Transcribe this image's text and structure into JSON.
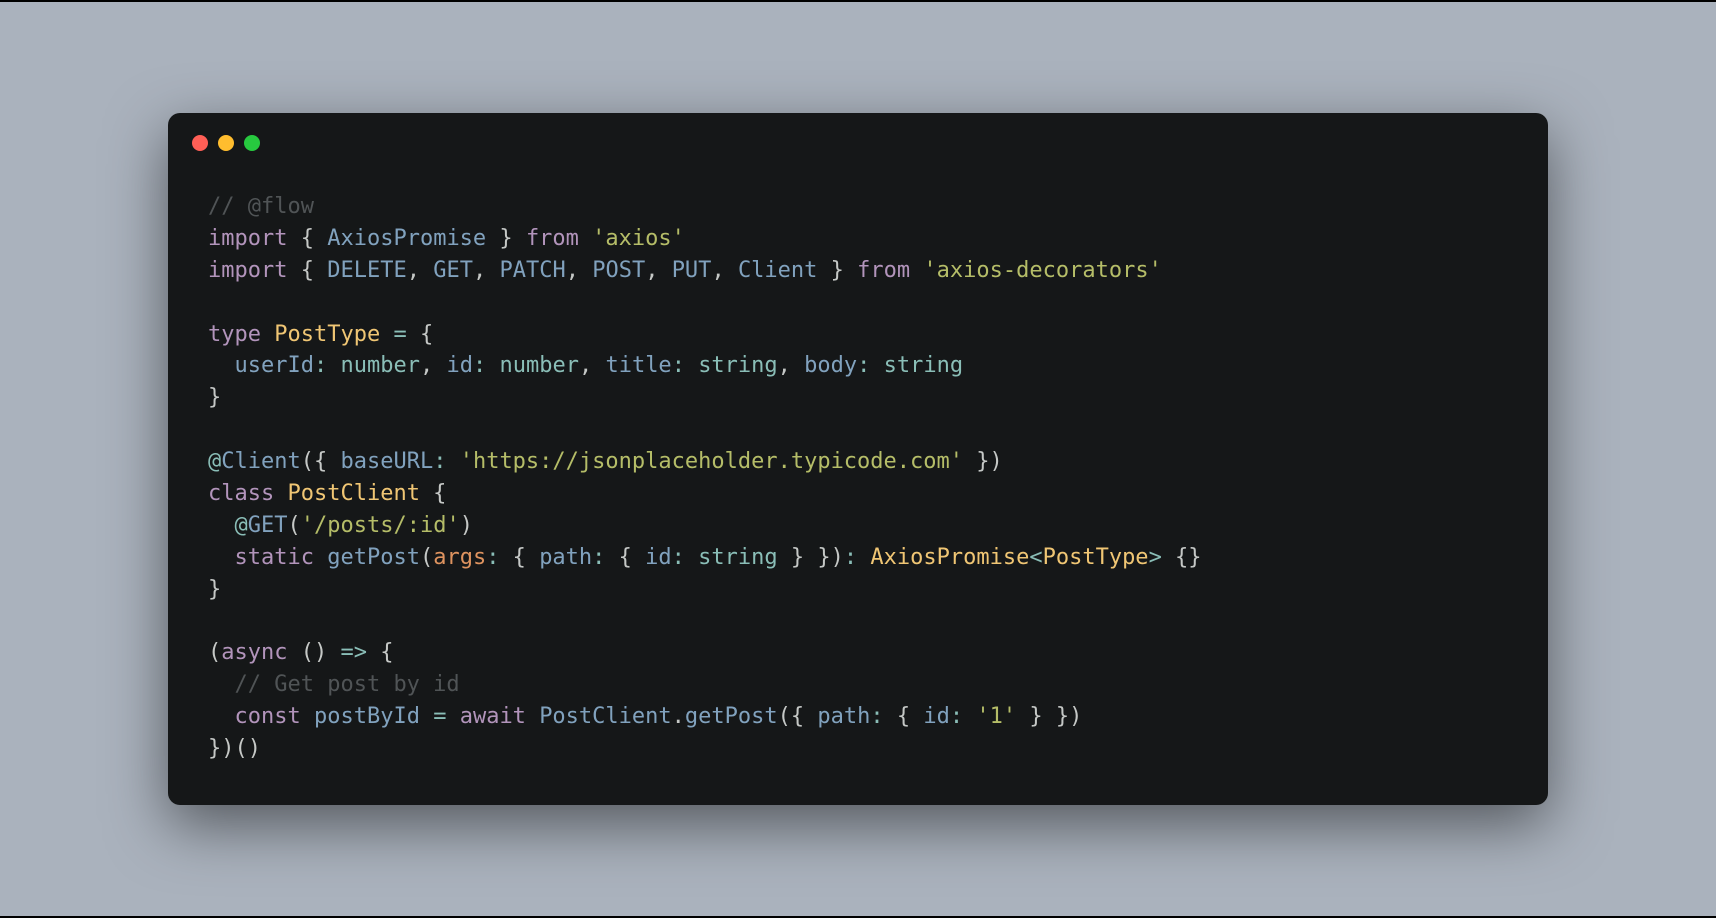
{
  "window": {
    "traffic_lights": [
      "red",
      "yellow",
      "green"
    ]
  },
  "code": {
    "lines": [
      [
        [
          "cm",
          "// @flow"
        ]
      ],
      [
        [
          "kw",
          "import"
        ],
        [
          "br",
          " { "
        ],
        [
          "fn",
          "AxiosPromise"
        ],
        [
          "br",
          " } "
        ],
        [
          "kw",
          "from"
        ],
        [
          "br",
          " "
        ],
        [
          "str",
          "'axios'"
        ]
      ],
      [
        [
          "kw",
          "import"
        ],
        [
          "br",
          " { "
        ],
        [
          "fn",
          "DELETE"
        ],
        [
          "br",
          ", "
        ],
        [
          "fn",
          "GET"
        ],
        [
          "br",
          ", "
        ],
        [
          "fn",
          "PATCH"
        ],
        [
          "br",
          ", "
        ],
        [
          "fn",
          "POST"
        ],
        [
          "br",
          ", "
        ],
        [
          "fn",
          "PUT"
        ],
        [
          "br",
          ", "
        ],
        [
          "fn",
          "Client"
        ],
        [
          "br",
          " } "
        ],
        [
          "kw",
          "from"
        ],
        [
          "br",
          " "
        ],
        [
          "str",
          "'axios-decorators'"
        ]
      ],
      [
        [
          "br",
          ""
        ]
      ],
      [
        [
          "kw",
          "type"
        ],
        [
          "br",
          " "
        ],
        [
          "yel",
          "PostType"
        ],
        [
          "br",
          " "
        ],
        [
          "op",
          "="
        ],
        [
          "br",
          " {"
        ]
      ],
      [
        [
          "br",
          "  "
        ],
        [
          "fn",
          "userId"
        ],
        [
          "op",
          ":"
        ],
        [
          "br",
          " "
        ],
        [
          "typ",
          "number"
        ],
        [
          "br",
          ", "
        ],
        [
          "fn",
          "id"
        ],
        [
          "op",
          ":"
        ],
        [
          "br",
          " "
        ],
        [
          "typ",
          "number"
        ],
        [
          "br",
          ", "
        ],
        [
          "fn",
          "title"
        ],
        [
          "op",
          ":"
        ],
        [
          "br",
          " "
        ],
        [
          "typ",
          "string"
        ],
        [
          "br",
          ", "
        ],
        [
          "fn",
          "body"
        ],
        [
          "op",
          ":"
        ],
        [
          "br",
          " "
        ],
        [
          "typ",
          "string"
        ]
      ],
      [
        [
          "br",
          "}"
        ]
      ],
      [
        [
          "br",
          ""
        ]
      ],
      [
        [
          "op",
          "@"
        ],
        [
          "fn",
          "Client"
        ],
        [
          "br",
          "({ "
        ],
        [
          "fn",
          "baseURL"
        ],
        [
          "op",
          ":"
        ],
        [
          "br",
          " "
        ],
        [
          "str",
          "'https://jsonplaceholder.typicode.com'"
        ],
        [
          "br",
          " })"
        ]
      ],
      [
        [
          "kw",
          "class"
        ],
        [
          "br",
          " "
        ],
        [
          "yel",
          "PostClient"
        ],
        [
          "br",
          " {"
        ]
      ],
      [
        [
          "br",
          "  "
        ],
        [
          "op",
          "@"
        ],
        [
          "fn",
          "GET"
        ],
        [
          "br",
          "("
        ],
        [
          "str",
          "'/posts/:id'"
        ],
        [
          "br",
          ")"
        ]
      ],
      [
        [
          "br",
          "  "
        ],
        [
          "kw",
          "static"
        ],
        [
          "br",
          " "
        ],
        [
          "fn",
          "getPost"
        ],
        [
          "br",
          "("
        ],
        [
          "or",
          "args"
        ],
        [
          "op",
          ":"
        ],
        [
          "br",
          " { "
        ],
        [
          "fn",
          "path"
        ],
        [
          "op",
          ":"
        ],
        [
          "br",
          " { "
        ],
        [
          "fn",
          "id"
        ],
        [
          "op",
          ":"
        ],
        [
          "br",
          " "
        ],
        [
          "typ",
          "string"
        ],
        [
          "br",
          " } })"
        ],
        [
          "op",
          ":"
        ],
        [
          "br",
          " "
        ],
        [
          "yel",
          "AxiosPromise"
        ],
        [
          "op",
          "<"
        ],
        [
          "yel",
          "PostType"
        ],
        [
          "op",
          ">"
        ],
        [
          "br",
          " {}"
        ]
      ],
      [
        [
          "br",
          "}"
        ]
      ],
      [
        [
          "br",
          ""
        ]
      ],
      [
        [
          "br",
          "("
        ],
        [
          "kw",
          "async"
        ],
        [
          "br",
          " () "
        ],
        [
          "op",
          "=>"
        ],
        [
          "br",
          " {"
        ]
      ],
      [
        [
          "br",
          "  "
        ],
        [
          "cm",
          "// Get post by id"
        ]
      ],
      [
        [
          "br",
          "  "
        ],
        [
          "kw",
          "const"
        ],
        [
          "br",
          " "
        ],
        [
          "fn",
          "postById"
        ],
        [
          "br",
          " "
        ],
        [
          "op",
          "="
        ],
        [
          "br",
          " "
        ],
        [
          "kw",
          "await"
        ],
        [
          "br",
          " "
        ],
        [
          "fn",
          "PostClient"
        ],
        [
          "br",
          "."
        ],
        [
          "fn",
          "getPost"
        ],
        [
          "br",
          "({ "
        ],
        [
          "fn",
          "path"
        ],
        [
          "op",
          ":"
        ],
        [
          "br",
          " { "
        ],
        [
          "fn",
          "id"
        ],
        [
          "op",
          ":"
        ],
        [
          "br",
          " "
        ],
        [
          "str",
          "'1'"
        ],
        [
          "br",
          " } })"
        ]
      ],
      [
        [
          "br",
          "})()"
        ]
      ]
    ]
  }
}
